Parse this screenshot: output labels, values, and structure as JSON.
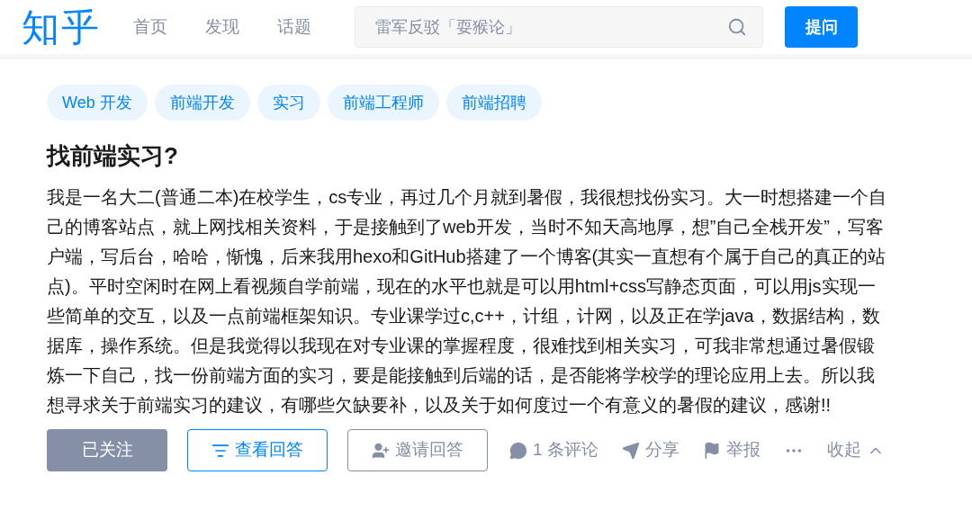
{
  "header": {
    "logo": "知乎",
    "nav": [
      {
        "label": "首页",
        "selected": false
      },
      {
        "label": "发现",
        "selected": false
      },
      {
        "label": "话题",
        "selected": false
      }
    ],
    "search": {
      "placeholder": "雷军反驳「耍猴论」"
    },
    "ask_button": "提问"
  },
  "question": {
    "topics": [
      "Web 开发",
      "前端开发",
      "实习",
      "前端工程师",
      "前端招聘"
    ],
    "title": "找前端实习?",
    "body": "我是一名大二(普通二本)在校学生，cs专业，再过几个月就到暑假，我很想找份实习。大一时想搭建一个自己的博客站点，就上网找相关资料，于是接触到了web开发，当时不知天高地厚，想”自己全栈开发”，写客户端，写后台，哈哈，惭愧，后来我用hexo和GitHub搭建了一个博客(其实一直想有个属于自己的真正的站点)。平时空闲时在网上看视频自学前端，现在的水平也就是可以用html+css写静态页面，可以用js实现一些简单的交互，以及一点前端框架知识。专业课学过c,c++，计组，计网，以及正在学java，数据结构，数据库，操作系统。但是我觉得以我现在对专业课的掌握程度，很难找到相关实习，可我非常想通过暑假锻炼一下自己，找一份前端方面的实习，要是能接触到后端的话，是否能将学校学的理论应用上去。所以我想寻求关于前端实习的建议，有哪些欠缺要补，以及关于如何度过一个有意义的暑假的建议，感谢!!",
    "follow_button": {
      "label": "已关注",
      "following": true
    },
    "view_answers_button": "查看回答",
    "invite_button": "邀请回答",
    "actions": [
      {
        "kind": "comment",
        "label": "1 条评论"
      },
      {
        "kind": "share",
        "label": "分享"
      },
      {
        "kind": "report",
        "label": "举报"
      },
      {
        "kind": "more"
      },
      {
        "kind": "collapse",
        "label": "收起"
      }
    ]
  }
}
